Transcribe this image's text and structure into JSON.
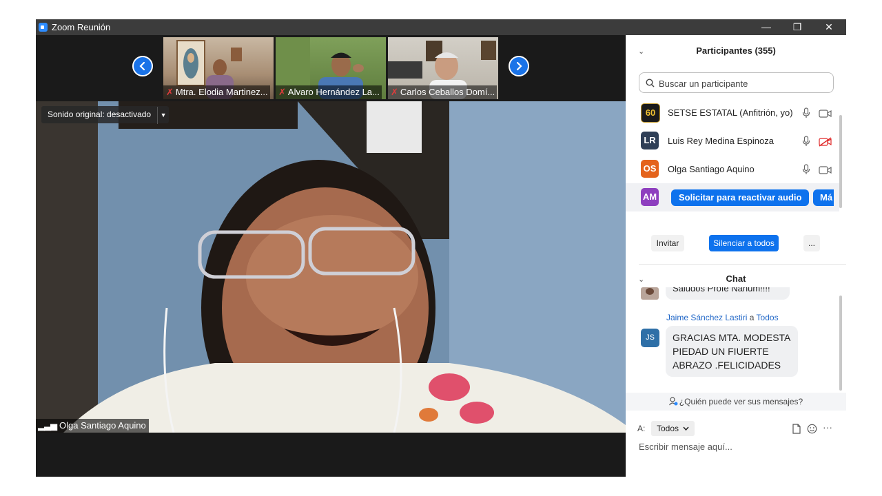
{
  "window": {
    "title": "Zoom Reunión",
    "minimize": "—",
    "restore": "❐",
    "close": "✕"
  },
  "video": {
    "thumbnails": [
      {
        "name": "Mtra. Elodia Martinez...",
        "muted": true
      },
      {
        "name": "Alvaro Hernández La...",
        "muted": true
      },
      {
        "name": "Carlos Ceballos Domí...",
        "muted": true
      }
    ],
    "sound_option": "Sonido original: desactivado",
    "active_speaker": "Olga Santiago Aquino"
  },
  "participants": {
    "title": "Participantes (355)",
    "search_placeholder": "Buscar un participante",
    "list": [
      {
        "initials": "60",
        "name": "SETSE ESTATAL (Anfitrión, yo)",
        "color": "#1b1b1b",
        "video_off": false
      },
      {
        "initials": "LR",
        "name": "Luis Rey Medina Espinoza",
        "color": "#2f3f57",
        "video_off": true
      },
      {
        "initials": "OS",
        "name": "Olga Santiago Aquino",
        "color": "#e4631c",
        "video_off": false
      },
      {
        "initials": "AM",
        "color": "#8e3fbf"
      }
    ],
    "unmute_request": "Solicitar para reactivar audio",
    "more_label": "Má",
    "invite": "Invitar",
    "mute_all": "Silenciar a todos",
    "more": "..."
  },
  "chat": {
    "title": "Chat",
    "prev_message": "Saludos Profe Nahum!!!!",
    "sender": "Jaime Sánchez Lastiri",
    "to_word": "a",
    "recipient": "Todos",
    "sender_initials": "JS",
    "message_lines": [
      "GRACIAS MTA. MODESTA",
      "PIEDAD UN FIUERTE",
      "ABRAZO .FELICIDADES"
    ],
    "who_can_see": "¿Quién puede ver sus mensajes?",
    "to_label": "A:",
    "to_value": "Todos",
    "input_placeholder": "Escribir mensaje aquí..."
  },
  "colors": {
    "accent": "#0e72ed",
    "link": "#2268c8",
    "titlebar": "#3c3c3c"
  }
}
